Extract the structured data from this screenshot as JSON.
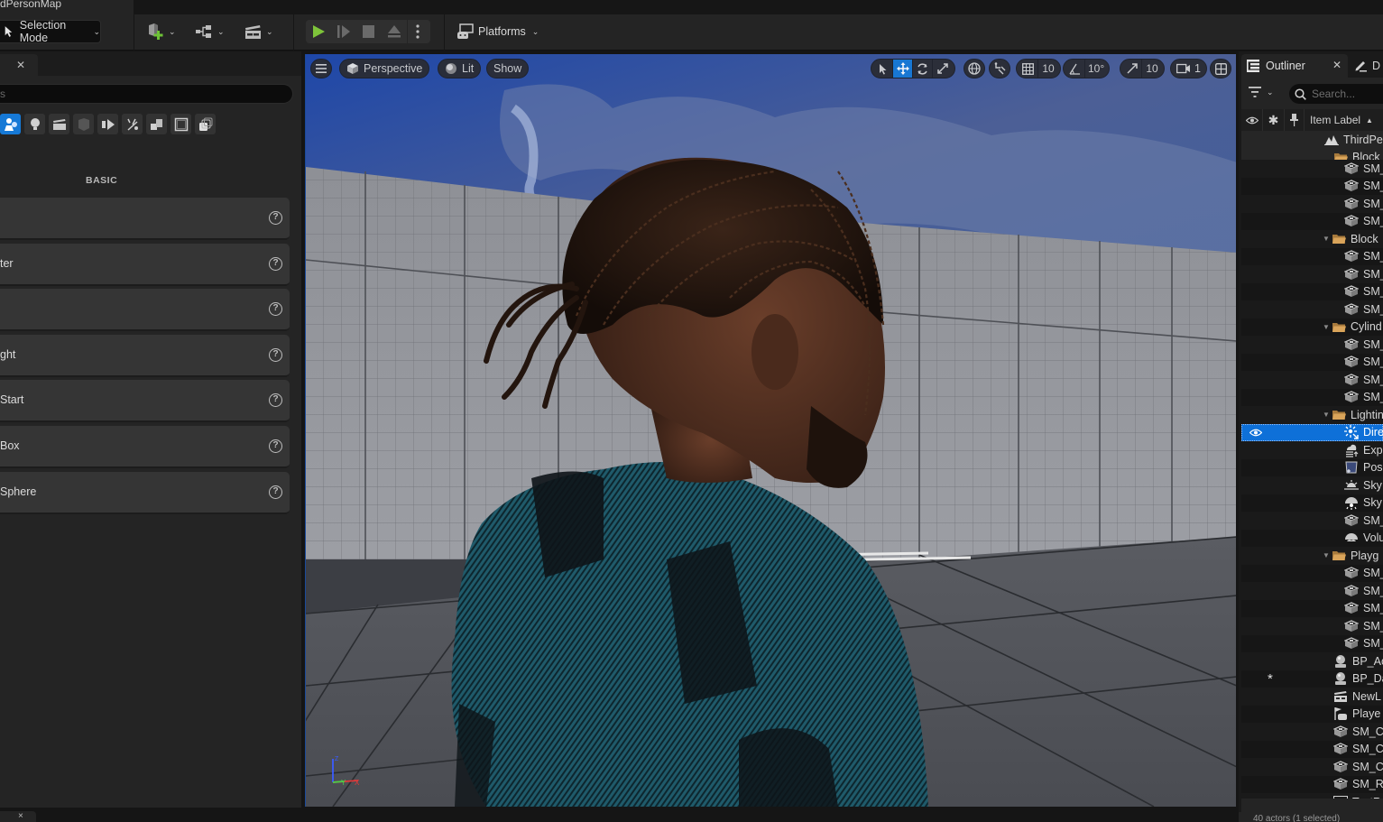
{
  "window": {
    "map_tab_title": "dPersonMap"
  },
  "toolbar": {
    "selection_mode_label": "Selection Mode",
    "platforms_label": "Platforms",
    "icons": [
      "add-actor-icon",
      "blueprint-icon",
      "cinematics-icon",
      "play-icon",
      "step-icon",
      "stop-icon",
      "eject-icon",
      "more-options-icon",
      "platforms-icon"
    ],
    "play_color": "#7ec43a"
  },
  "place_actors": {
    "search_placeholder": "s",
    "category_icons": [
      "recently-placed-icon",
      "light-icon",
      "cinematic-icon",
      "visual-effects-icon",
      "geometry-icon",
      "volumes-icon",
      "all-classes-icon",
      "shapes-icon",
      "layers-icon"
    ],
    "active_category_index": 0,
    "section_title": "BASIC",
    "items": [
      {
        "label": ""
      },
      {
        "label": "ter"
      },
      {
        "label": ""
      },
      {
        "label": "ght"
      },
      {
        "label": "Start"
      },
      {
        "label": " Box"
      },
      {
        "label": " Sphere"
      }
    ],
    "help_glyph": "?"
  },
  "viewport": {
    "menu_icon": "hamburger-icon",
    "perspective_label": "Perspective",
    "lit_label": "Lit",
    "show_label": "Show",
    "grid_snap_value": "10",
    "rotation_snap_value": "10°",
    "scale_snap_value": "10",
    "camera_speed_value": "1",
    "active_transform_tool": "translate",
    "axis_labels": {
      "z": "Z",
      "y": "Y",
      "x": "X"
    }
  },
  "outliner": {
    "tab_label": "Outliner",
    "details_tab_label": "D",
    "search_placeholder": "Search...",
    "column_label": "Item Label",
    "sort_glyph": "▲",
    "rows": [
      {
        "label": "ThirdPe",
        "icon": "level-icon",
        "indent": 1,
        "arrow": false
      },
      {
        "label": "Block",
        "icon": "folder-icon",
        "indent": 2,
        "arrow": false
      },
      {
        "label": "SM_",
        "icon": "static-mesh-icon",
        "indent": 3,
        "arrow": false
      },
      {
        "label": "SM_",
        "icon": "static-mesh-icon",
        "indent": 3,
        "arrow": false
      },
      {
        "label": "SM_",
        "icon": "static-mesh-icon",
        "indent": 3,
        "arrow": false
      },
      {
        "label": "SM_",
        "icon": "static-mesh-icon",
        "indent": 3,
        "arrow": false
      },
      {
        "label": "Block",
        "icon": "folder-icon",
        "indent": 2,
        "arrow": true
      },
      {
        "label": "SM_",
        "icon": "static-mesh-icon",
        "indent": 3,
        "arrow": false
      },
      {
        "label": "SM_",
        "icon": "static-mesh-icon",
        "indent": 3,
        "arrow": false
      },
      {
        "label": "SM_",
        "icon": "static-mesh-icon",
        "indent": 3,
        "arrow": false
      },
      {
        "label": "SM_",
        "icon": "static-mesh-icon",
        "indent": 3,
        "arrow": false
      },
      {
        "label": "Cylind",
        "icon": "folder-icon",
        "indent": 2,
        "arrow": true
      },
      {
        "label": "SM_",
        "icon": "static-mesh-icon",
        "indent": 3,
        "arrow": false
      },
      {
        "label": "SM_",
        "icon": "static-mesh-icon",
        "indent": 3,
        "arrow": false
      },
      {
        "label": "SM_",
        "icon": "static-mesh-icon",
        "indent": 3,
        "arrow": false
      },
      {
        "label": "SM_",
        "icon": "static-mesh-icon",
        "indent": 3,
        "arrow": false
      },
      {
        "label": "Lightin",
        "icon": "folder-icon",
        "indent": 2,
        "arrow": true
      },
      {
        "label": "Dire",
        "icon": "directional-light-icon",
        "indent": 3,
        "arrow": false,
        "selected": true
      },
      {
        "label": "Exp",
        "icon": "exponential-fog-icon",
        "indent": 3,
        "arrow": false
      },
      {
        "label": "Pos",
        "icon": "post-process-icon",
        "indent": 3,
        "arrow": false
      },
      {
        "label": "Sky",
        "icon": "sky-atmosphere-icon",
        "indent": 3,
        "arrow": false
      },
      {
        "label": "Sky",
        "icon": "sky-light-icon",
        "indent": 3,
        "arrow": false
      },
      {
        "label": "SM_",
        "icon": "static-mesh-icon",
        "indent": 3,
        "arrow": false
      },
      {
        "label": "Volu",
        "icon": "volumetric-cloud-icon",
        "indent": 3,
        "arrow": false
      },
      {
        "label": "Playg",
        "icon": "folder-icon",
        "indent": 2,
        "arrow": true
      },
      {
        "label": "SM_",
        "icon": "static-mesh-icon",
        "indent": 3,
        "arrow": false
      },
      {
        "label": "SM_",
        "icon": "static-mesh-icon",
        "indent": 3,
        "arrow": false
      },
      {
        "label": "SM_",
        "icon": "static-mesh-icon",
        "indent": 3,
        "arrow": false
      },
      {
        "label": "SM_",
        "icon": "static-mesh-icon",
        "indent": 3,
        "arrow": false
      },
      {
        "label": "SM_",
        "icon": "static-mesh-icon",
        "indent": 3,
        "arrow": false
      },
      {
        "label": "BP_Ac",
        "icon": "blueprint-actor-icon",
        "indent": 2,
        "arrow": false
      },
      {
        "label": "BP_Da",
        "icon": "blueprint-actor-icon",
        "indent": 2,
        "arrow": false,
        "star": true
      },
      {
        "label": "NewL",
        "icon": "level-sequence-icon",
        "indent": 2,
        "arrow": false
      },
      {
        "label": "Playe",
        "icon": "player-start-icon",
        "indent": 2,
        "arrow": false
      },
      {
        "label": "SM_C",
        "icon": "static-mesh-icon",
        "indent": 2,
        "arrow": false
      },
      {
        "label": "SM_C",
        "icon": "static-mesh-icon",
        "indent": 2,
        "arrow": false
      },
      {
        "label": "SM_C",
        "icon": "static-mesh-icon",
        "indent": 2,
        "arrow": false
      },
      {
        "label": "SM_R",
        "icon": "static-mesh-icon",
        "indent": 2,
        "arrow": false
      },
      {
        "label": "TextR",
        "icon": "text-render-icon",
        "indent": 2,
        "arrow": false
      }
    ],
    "footer_text": "40 actors (1 selected)",
    "selected_color": "#0e70d8",
    "folder_color": "#c9934a"
  },
  "bottom": {
    "tab_close_glyph": "×"
  }
}
